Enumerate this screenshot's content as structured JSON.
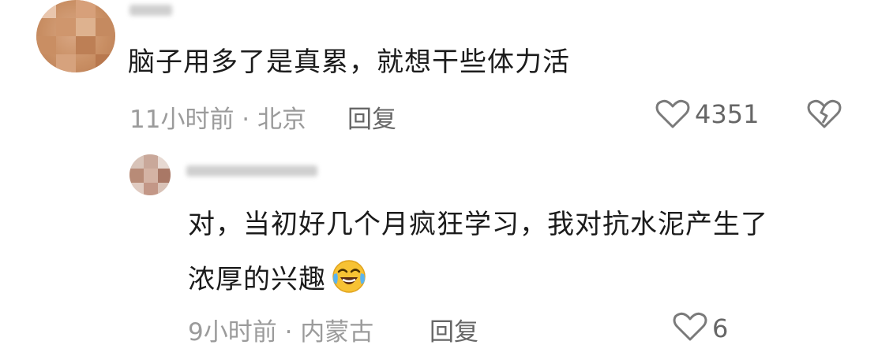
{
  "comment": {
    "text": "脑子用多了是真累，就想干些体力活",
    "time_location": "11小时前 · 北京",
    "reply_label": "回复",
    "like_count": "4351"
  },
  "reply": {
    "text_line1": "对，当初好几个月疯狂学习，我对抗水泥产生了",
    "text_line2": "浓厚的兴趣",
    "time_location": "9小时前 · 内蒙古",
    "reply_label": "回复",
    "like_count_partial": "6"
  },
  "colors": {
    "text_main": "#1b1b1b",
    "text_meta": "#9b9b9b",
    "icon_gray": "#7a7a7a",
    "emoji_yellow": "#f7c234",
    "emoji_tear": "#5ab4f0"
  }
}
